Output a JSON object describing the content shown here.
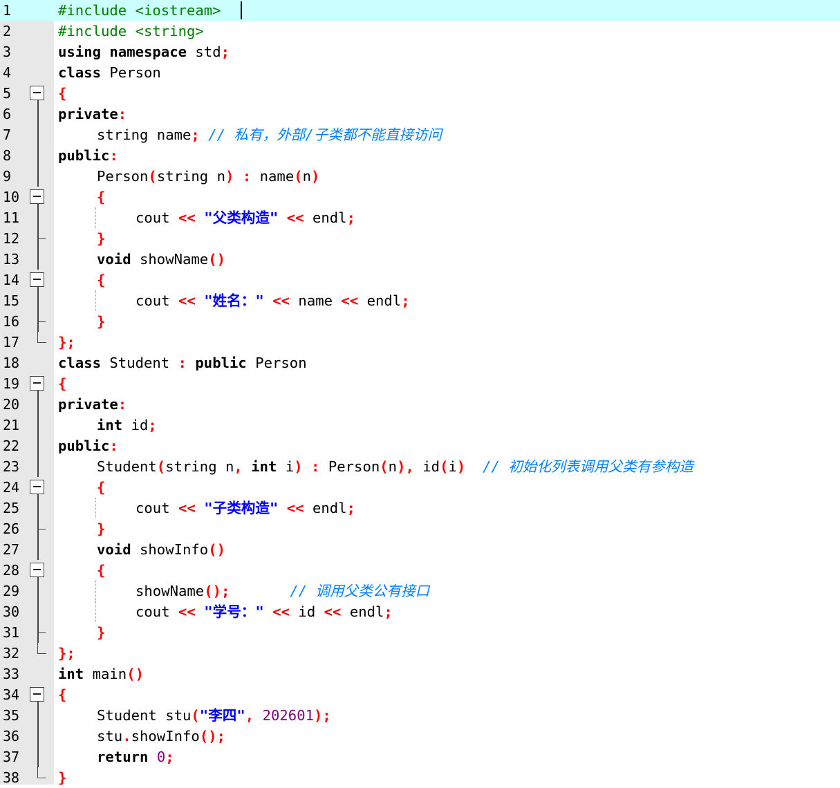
{
  "editor": {
    "language": "C++",
    "current_line": 1,
    "colors": {
      "keyword": "#000000",
      "preprocessor": "#008000",
      "operator": "#ff0000",
      "string": "#0000ff",
      "number": "#800080",
      "comment": "#0080ff",
      "current_line_bg": "#ccffff",
      "gutter_bg": "#e8e8e8"
    },
    "lines": [
      {
        "n": "1",
        "fold": "",
        "indent": 0,
        "tokens": [
          [
            "pp",
            "#include <iostream>"
          ]
        ]
      },
      {
        "n": "2",
        "fold": "",
        "indent": 0,
        "tokens": [
          [
            "pp",
            "#include <string>"
          ]
        ]
      },
      {
        "n": "3",
        "fold": "",
        "indent": 0,
        "tokens": [
          [
            "kw",
            "using"
          ],
          [
            "id",
            " "
          ],
          [
            "kw",
            "namespace"
          ],
          [
            "id",
            " std"
          ],
          [
            "op",
            ";"
          ]
        ]
      },
      {
        "n": "4",
        "fold": "",
        "indent": 0,
        "tokens": [
          [
            "kw",
            "class"
          ],
          [
            "id",
            " Person"
          ]
        ]
      },
      {
        "n": "5",
        "fold": "open",
        "indent": 0,
        "tokens": [
          [
            "op",
            "{"
          ]
        ]
      },
      {
        "n": "6",
        "fold": "line",
        "indent": 0,
        "tokens": [
          [
            "kw",
            "private"
          ],
          [
            "op",
            ":"
          ]
        ]
      },
      {
        "n": "7",
        "fold": "line",
        "indent": 1,
        "tokens": [
          [
            "id",
            "string name"
          ],
          [
            "op",
            ";"
          ],
          [
            "id",
            " "
          ],
          [
            "cm",
            "// 私有，外部/子类都不能直接访问"
          ]
        ]
      },
      {
        "n": "8",
        "fold": "line",
        "indent": 0,
        "tokens": [
          [
            "kw",
            "public"
          ],
          [
            "op",
            ":"
          ]
        ]
      },
      {
        "n": "9",
        "fold": "line",
        "indent": 1,
        "tokens": [
          [
            "id",
            "Person"
          ],
          [
            "op",
            "("
          ],
          [
            "id",
            "string n"
          ],
          [
            "op",
            ")"
          ],
          [
            "id",
            " "
          ],
          [
            "op",
            ":"
          ],
          [
            "id",
            " name"
          ],
          [
            "op",
            "("
          ],
          [
            "id",
            "n"
          ],
          [
            "op",
            ")"
          ]
        ]
      },
      {
        "n": "10",
        "fold": "open",
        "indent": 1,
        "tokens": [
          [
            "op",
            "{"
          ]
        ]
      },
      {
        "n": "11",
        "fold": "line",
        "indent": 2,
        "tokens": [
          [
            "id",
            "cout "
          ],
          [
            "op",
            "<<"
          ],
          [
            "id",
            " "
          ],
          [
            "str",
            "\"父类构造\""
          ],
          [
            "id",
            " "
          ],
          [
            "op",
            "<<"
          ],
          [
            "id",
            " endl"
          ],
          [
            "op",
            ";"
          ]
        ]
      },
      {
        "n": "12",
        "fold": "tee",
        "indent": 1,
        "tokens": [
          [
            "op",
            "}"
          ]
        ]
      },
      {
        "n": "13",
        "fold": "line",
        "indent": 1,
        "tokens": [
          [
            "kw",
            "void"
          ],
          [
            "id",
            " showName"
          ],
          [
            "op",
            "()"
          ]
        ]
      },
      {
        "n": "14",
        "fold": "open",
        "indent": 1,
        "tokens": [
          [
            "op",
            "{"
          ]
        ]
      },
      {
        "n": "15",
        "fold": "line",
        "indent": 2,
        "tokens": [
          [
            "id",
            "cout "
          ],
          [
            "op",
            "<<"
          ],
          [
            "id",
            " "
          ],
          [
            "str",
            "\"姓名：\""
          ],
          [
            "id",
            " "
          ],
          [
            "op",
            "<<"
          ],
          [
            "id",
            " name "
          ],
          [
            "op",
            "<<"
          ],
          [
            "id",
            " endl"
          ],
          [
            "op",
            ";"
          ]
        ]
      },
      {
        "n": "16",
        "fold": "tee",
        "indent": 1,
        "tokens": [
          [
            "op",
            "}"
          ]
        ]
      },
      {
        "n": "17",
        "fold": "end",
        "indent": 0,
        "tokens": [
          [
            "op",
            "};"
          ]
        ]
      },
      {
        "n": "18",
        "fold": "",
        "indent": 0,
        "tokens": [
          [
            "kw",
            "class"
          ],
          [
            "id",
            " Student "
          ],
          [
            "op",
            ":"
          ],
          [
            "id",
            " "
          ],
          [
            "kw",
            "public"
          ],
          [
            "id",
            " Person"
          ]
        ]
      },
      {
        "n": "19",
        "fold": "open",
        "indent": 0,
        "tokens": [
          [
            "op",
            "{"
          ]
        ]
      },
      {
        "n": "20",
        "fold": "line",
        "indent": 0,
        "tokens": [
          [
            "kw",
            "private"
          ],
          [
            "op",
            ":"
          ]
        ]
      },
      {
        "n": "21",
        "fold": "line",
        "indent": 1,
        "tokens": [
          [
            "kw",
            "int"
          ],
          [
            "id",
            " id"
          ],
          [
            "op",
            ";"
          ]
        ]
      },
      {
        "n": "22",
        "fold": "line",
        "indent": 0,
        "tokens": [
          [
            "kw",
            "public"
          ],
          [
            "op",
            ":"
          ]
        ]
      },
      {
        "n": "23",
        "fold": "line",
        "indent": 1,
        "tokens": [
          [
            "id",
            "Student"
          ],
          [
            "op",
            "("
          ],
          [
            "id",
            "string n"
          ],
          [
            "op",
            ","
          ],
          [
            "id",
            " "
          ],
          [
            "kw",
            "int"
          ],
          [
            "id",
            " i"
          ],
          [
            "op",
            ")"
          ],
          [
            "id",
            " "
          ],
          [
            "op",
            ":"
          ],
          [
            "id",
            " Person"
          ],
          [
            "op",
            "("
          ],
          [
            "id",
            "n"
          ],
          [
            "op",
            "),"
          ],
          [
            "id",
            " id"
          ],
          [
            "op",
            "("
          ],
          [
            "id",
            "i"
          ],
          [
            "op",
            ")"
          ],
          [
            "id",
            "  "
          ],
          [
            "cm",
            "// 初始化列表调用父类有参构造"
          ]
        ]
      },
      {
        "n": "24",
        "fold": "open",
        "indent": 1,
        "tokens": [
          [
            "op",
            "{"
          ]
        ]
      },
      {
        "n": "25",
        "fold": "line",
        "indent": 2,
        "tokens": [
          [
            "id",
            "cout "
          ],
          [
            "op",
            "<<"
          ],
          [
            "id",
            " "
          ],
          [
            "str",
            "\"子类构造\""
          ],
          [
            "id",
            " "
          ],
          [
            "op",
            "<<"
          ],
          [
            "id",
            " endl"
          ],
          [
            "op",
            ";"
          ]
        ]
      },
      {
        "n": "26",
        "fold": "tee",
        "indent": 1,
        "tokens": [
          [
            "op",
            "}"
          ]
        ]
      },
      {
        "n": "27",
        "fold": "line",
        "indent": 1,
        "tokens": [
          [
            "kw",
            "void"
          ],
          [
            "id",
            " showInfo"
          ],
          [
            "op",
            "()"
          ]
        ]
      },
      {
        "n": "28",
        "fold": "open",
        "indent": 1,
        "tokens": [
          [
            "op",
            "{"
          ]
        ]
      },
      {
        "n": "29",
        "fold": "line",
        "indent": 2,
        "tokens": [
          [
            "id",
            "showName"
          ],
          [
            "op",
            "();"
          ],
          [
            "id",
            "       "
          ],
          [
            "cm",
            "// 调用父类公有接口"
          ]
        ]
      },
      {
        "n": "30",
        "fold": "line",
        "indent": 2,
        "tokens": [
          [
            "id",
            "cout "
          ],
          [
            "op",
            "<<"
          ],
          [
            "id",
            " "
          ],
          [
            "str",
            "\"学号：\""
          ],
          [
            "id",
            " "
          ],
          [
            "op",
            "<<"
          ],
          [
            "id",
            " id "
          ],
          [
            "op",
            "<<"
          ],
          [
            "id",
            " endl"
          ],
          [
            "op",
            ";"
          ]
        ]
      },
      {
        "n": "31",
        "fold": "tee",
        "indent": 1,
        "tokens": [
          [
            "op",
            "}"
          ]
        ]
      },
      {
        "n": "32",
        "fold": "end",
        "indent": 0,
        "tokens": [
          [
            "op",
            "};"
          ]
        ]
      },
      {
        "n": "33",
        "fold": "",
        "indent": 0,
        "tokens": [
          [
            "kw",
            "int"
          ],
          [
            "id",
            " main"
          ],
          [
            "op",
            "()"
          ]
        ]
      },
      {
        "n": "34",
        "fold": "open",
        "indent": 0,
        "tokens": [
          [
            "op",
            "{"
          ]
        ]
      },
      {
        "n": "35",
        "fold": "line",
        "indent": 1,
        "tokens": [
          [
            "id",
            "Student stu"
          ],
          [
            "op",
            "("
          ],
          [
            "str",
            "\"李四\""
          ],
          [
            "op",
            ","
          ],
          [
            "id",
            " "
          ],
          [
            "num",
            "202601"
          ],
          [
            "op",
            ");"
          ]
        ]
      },
      {
        "n": "36",
        "fold": "line",
        "indent": 1,
        "tokens": [
          [
            "id",
            "stu"
          ],
          [
            "op",
            "."
          ],
          [
            "id",
            "showInfo"
          ],
          [
            "op",
            "();"
          ]
        ]
      },
      {
        "n": "37",
        "fold": "line",
        "indent": 1,
        "tokens": [
          [
            "kw",
            "return"
          ],
          [
            "id",
            " "
          ],
          [
            "num",
            "0"
          ],
          [
            "op",
            ";"
          ]
        ]
      },
      {
        "n": "38",
        "fold": "end",
        "indent": 0,
        "tokens": [
          [
            "op",
            "}"
          ]
        ]
      }
    ]
  }
}
